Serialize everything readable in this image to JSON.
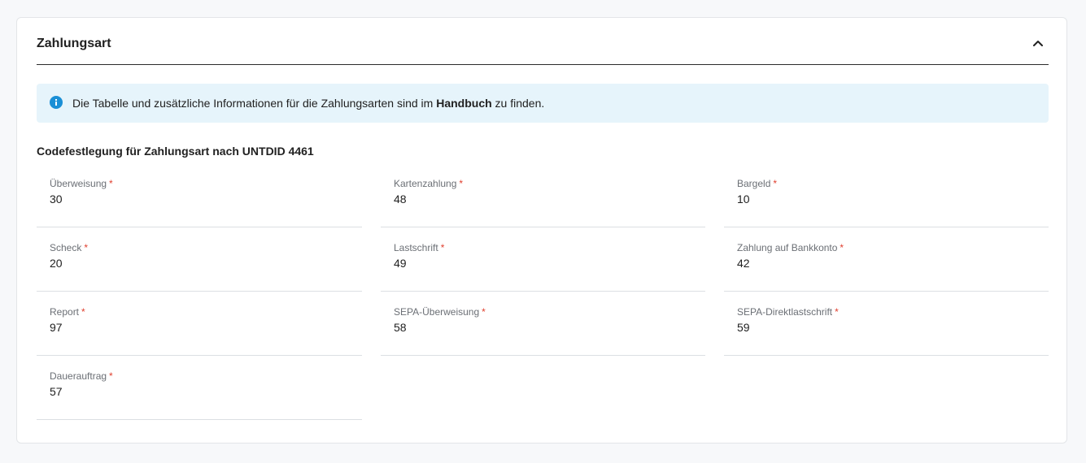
{
  "section": {
    "title": "Zahlungsart",
    "collapse_icon": "chevron-up-icon"
  },
  "info": {
    "icon": "info-icon",
    "text_before": "Die Tabelle und zusätzliche Informationen für die Zahlungsarten sind im ",
    "link_text": "Handbuch",
    "text_after": " zu finden."
  },
  "codes": {
    "title": "Codefestlegung für Zahlungsart nach UNTDID 4461",
    "required_marker": "*",
    "fields": [
      {
        "label": "Überweisung",
        "value": "30"
      },
      {
        "label": "Kartenzahlung",
        "value": "48"
      },
      {
        "label": "Bargeld",
        "value": "10"
      },
      {
        "label": "Scheck",
        "value": "20"
      },
      {
        "label": "Lastschrift",
        "value": "49"
      },
      {
        "label": "Zahlung auf Bankkonto",
        "value": "42"
      },
      {
        "label": "Report",
        "value": "97"
      },
      {
        "label": "SEPA-Überweisung",
        "value": "58"
      },
      {
        "label": "SEPA-Direktlastschrift",
        "value": "59"
      },
      {
        "label": "Dauerauftrag",
        "value": "57"
      }
    ]
  },
  "colors": {
    "info_background": "#e6f4fb",
    "info_icon": "#1a8fd6",
    "required": "#e0402f",
    "divider": "#2b2b2b"
  }
}
